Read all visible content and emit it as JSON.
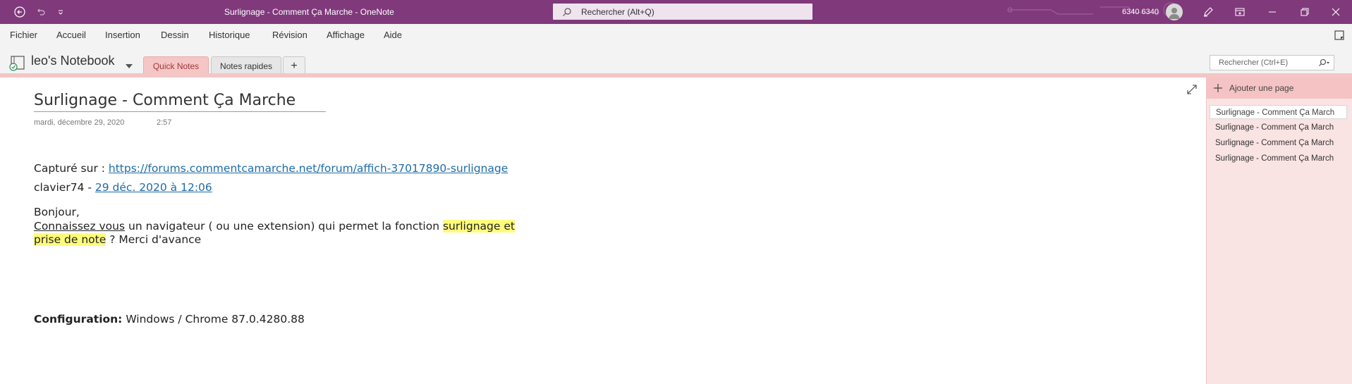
{
  "titlebar": {
    "title": "Surlignage - Comment Ça Marche  -  OneNote",
    "search_placeholder": "Rechercher (Alt+Q)",
    "user": "6340 6340"
  },
  "menu": {
    "items": [
      "Fichier",
      "Accueil",
      "Insertion",
      "Dessin",
      "Historique",
      "Révision",
      "Affichage",
      "Aide"
    ]
  },
  "notebook": {
    "name": "leo's Notebook",
    "tabs": [
      "Quick Notes",
      "Notes rapides",
      "+"
    ],
    "page_search_placeholder": "Rechercher (Ctrl+E)"
  },
  "page": {
    "title": "Surlignage - Comment Ça Marche",
    "date": "mardi, décembre 29, 2020",
    "time": "2:57",
    "captured_label": "Capturé sur : ",
    "captured_url": "https://forums.commentcamarche.net/forum/affich-37017890-surlignage",
    "author": "clavier74 - ",
    "author_date": "29 déc. 2020 à 12:06",
    "greeting": "Bonjour,",
    "body_part1": "Connaissez vous",
    "body_part2": " un navigateur ( ou une extension) qui permet la fonction ",
    "body_hl1": "surlignage",
    "body_part3": " et ",
    "body_hl2": "prise de note",
    "body_part4": " ? Merci d'avance",
    "config_label": "Configuration:",
    "config_value": " Windows / Chrome 87.0.4280.88"
  },
  "pages_panel": {
    "add_label": "Ajouter une page",
    "items": [
      "Surlignage - Comment Ça March",
      "Surlignage - Comment Ça March",
      "Surlignage - Comment Ça March",
      "Surlignage - Comment Ça March"
    ]
  },
  "colors": {
    "titlebar": "#80397b",
    "tab_active": "#f4c6c6",
    "highlight": "#fefc7a",
    "link": "#1e6ca8"
  }
}
